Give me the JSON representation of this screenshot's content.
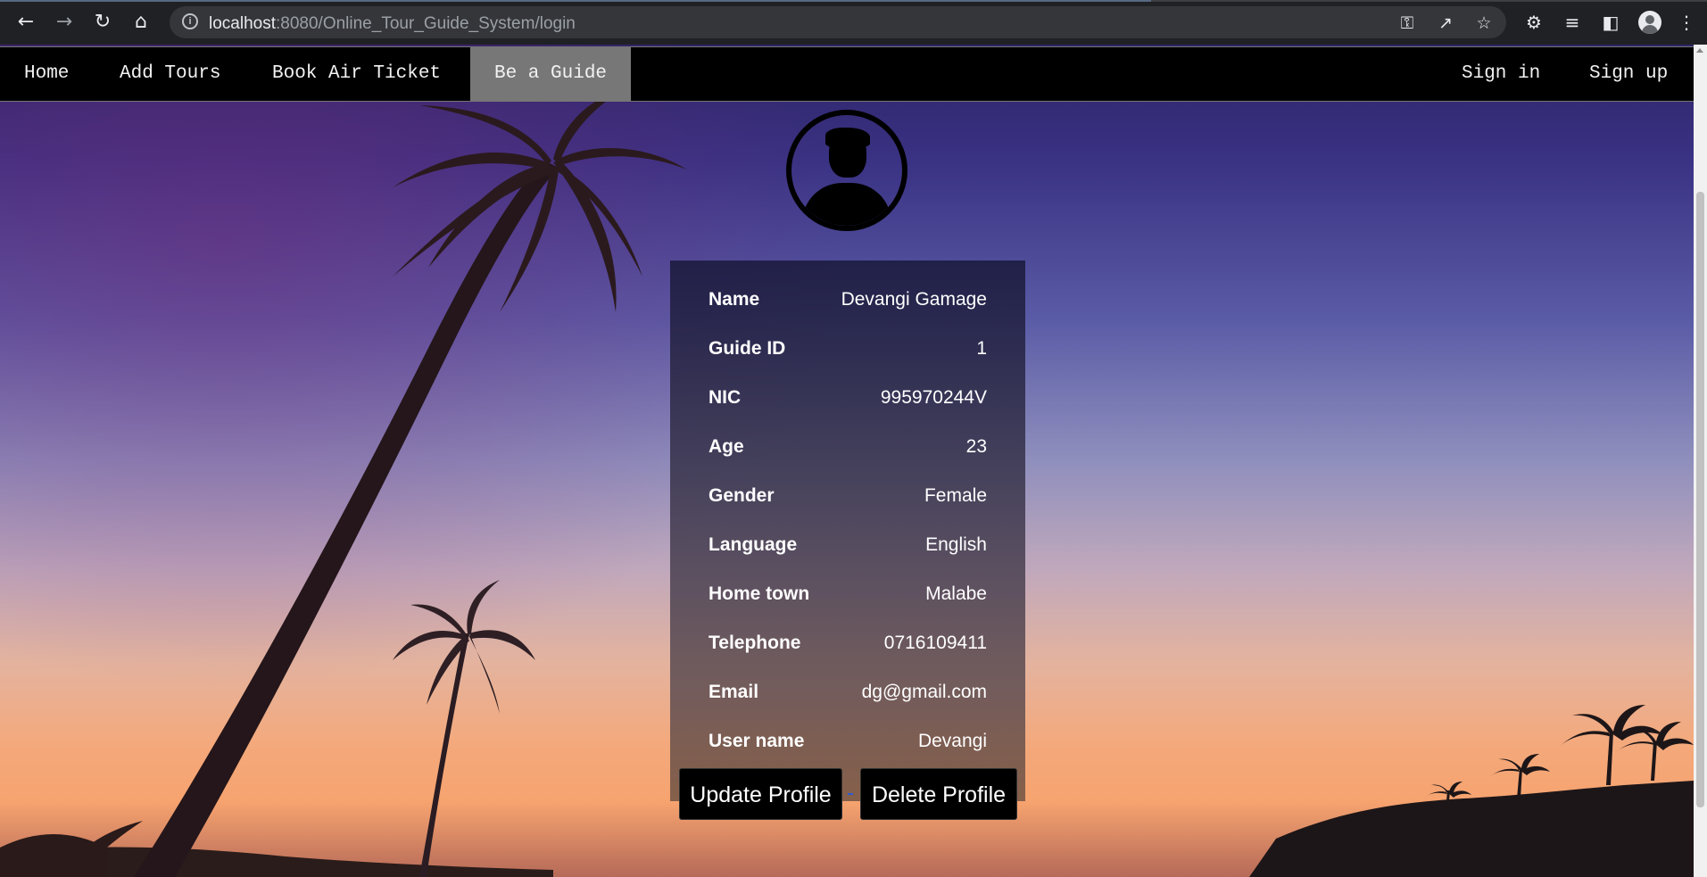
{
  "browser": {
    "url_host": "localhost",
    "url_rest": ":8080/Online_Tour_Guide_System/login",
    "icons": [
      "back-icon",
      "forward-icon",
      "reload-icon",
      "home-icon",
      "info-icon",
      "key-icon",
      "share-icon",
      "star-icon",
      "extensions-icon",
      "reading-list-icon",
      "side-panel-icon",
      "profile-icon",
      "menu-icon"
    ]
  },
  "nav": {
    "items": [
      {
        "label": "Home"
      },
      {
        "label": "Add Tours"
      },
      {
        "label": "Book Air Ticket"
      },
      {
        "label": "Be a Guide",
        "active": true
      }
    ],
    "right_items": [
      {
        "label": "Sign in"
      },
      {
        "label": "Sign up"
      }
    ],
    "background": "#000000",
    "active_background": "#777777"
  },
  "profile": {
    "fields": [
      {
        "label": "Name",
        "value": "Devangi Gamage"
      },
      {
        "label": "Guide ID",
        "value": "1"
      },
      {
        "label": "NIC",
        "value": "995970244V"
      },
      {
        "label": "Age",
        "value": "23"
      },
      {
        "label": "Gender",
        "value": "Female"
      },
      {
        "label": "Language",
        "value": "English"
      },
      {
        "label": "Home town",
        "value": "Malabe"
      },
      {
        "label": "Telephone",
        "value": "0716109411"
      },
      {
        "label": "Email",
        "value": "dg@gmail.com"
      },
      {
        "label": "User name",
        "value": "Devangi"
      }
    ]
  },
  "actions": {
    "update_label": "Update Profile",
    "delete_label": "Delete Profile"
  }
}
